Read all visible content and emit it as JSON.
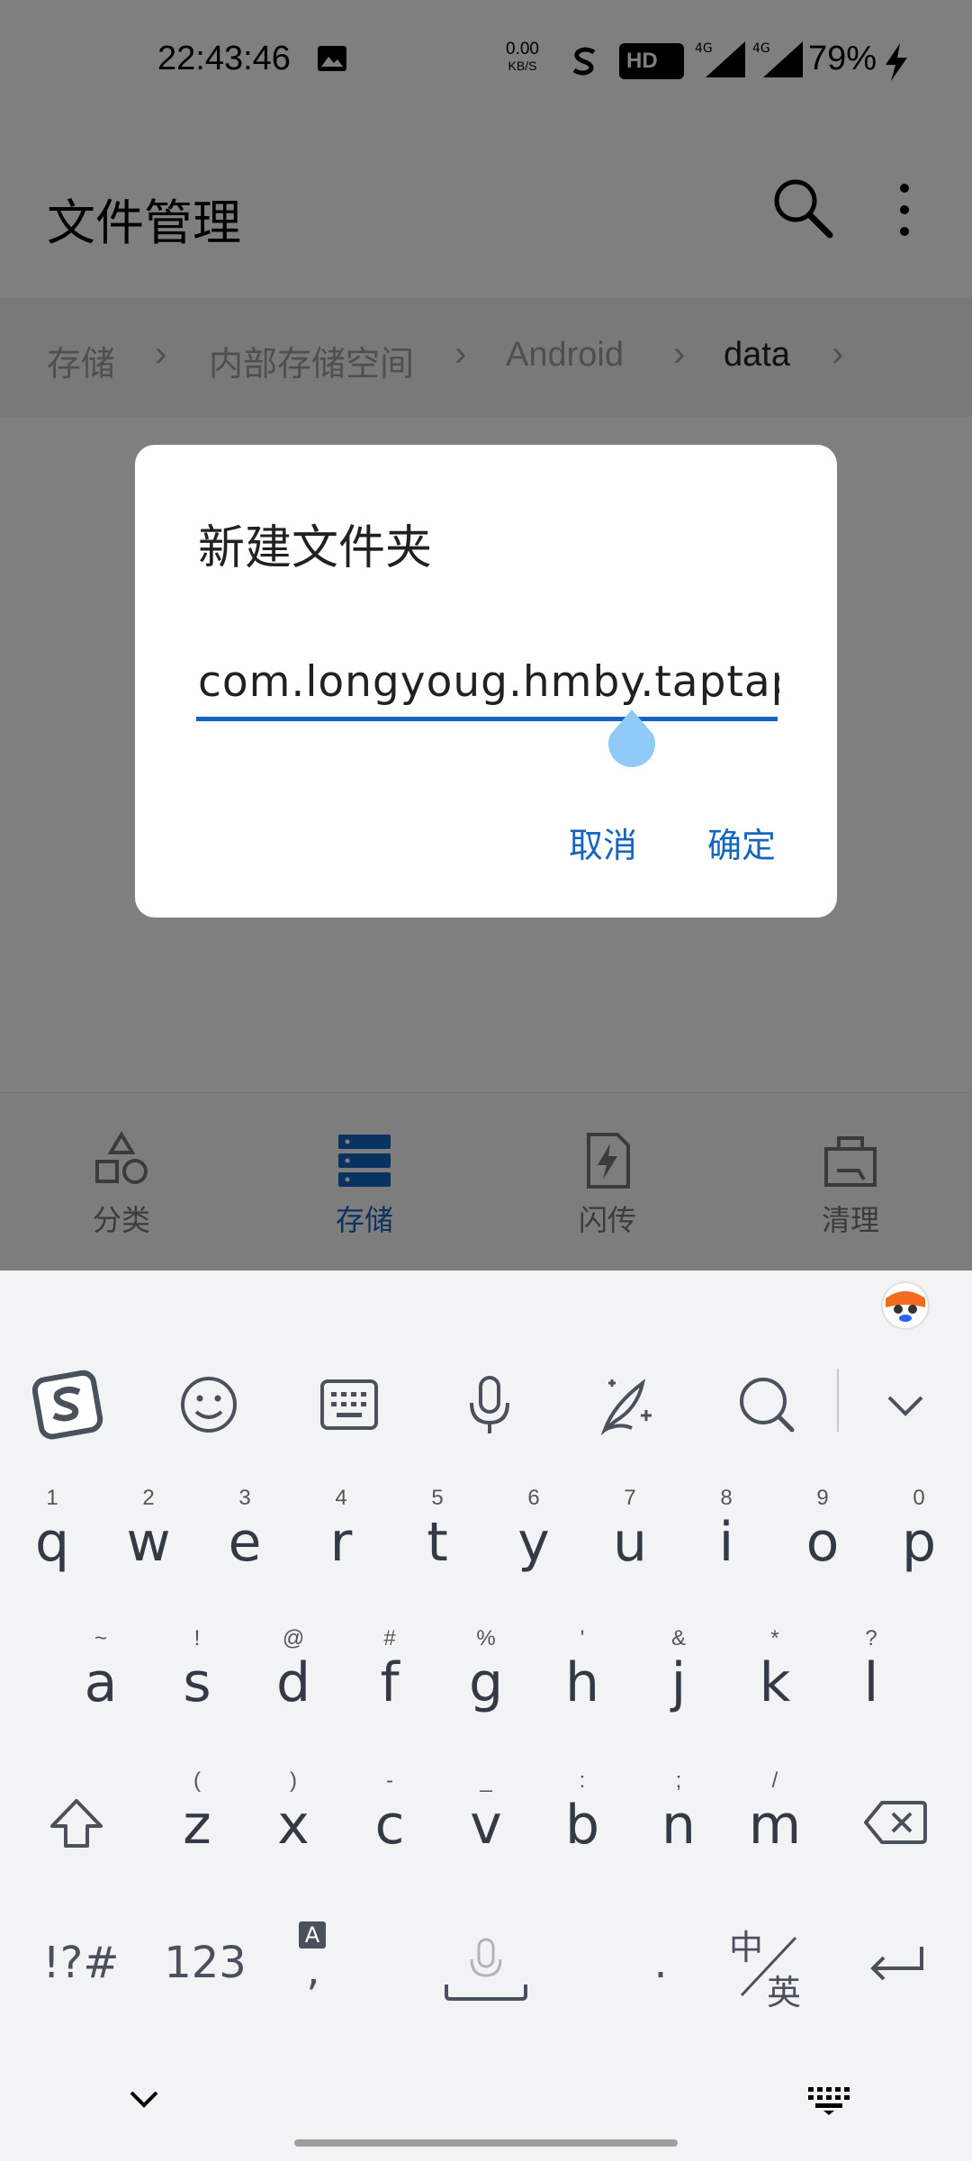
{
  "status_bar": {
    "time": "22:43:46",
    "net_speed_value": "0.00",
    "net_speed_unit": "KB/S",
    "hd_label": "HD",
    "network_1": "4G",
    "network_2": "4G",
    "battery": "79%"
  },
  "app_bar": {
    "title": "文件管理"
  },
  "breadcrumb": [
    "存储",
    "内部存储空间",
    "Android",
    "data"
  ],
  "bottom_nav": [
    {
      "label": "分类",
      "icon": "category-icon",
      "active": false
    },
    {
      "label": "存储",
      "icon": "storage-icon",
      "active": true
    },
    {
      "label": "闪传",
      "icon": "flash-transfer-icon",
      "active": false
    },
    {
      "label": "清理",
      "icon": "cleanup-icon",
      "active": false
    }
  ],
  "dialog": {
    "title": "新建文件夹",
    "input_value": "com.longyoug.hmby.taptap",
    "cancel_label": "取消",
    "confirm_label": "确定"
  },
  "keyboard": {
    "toolbar": [
      "sogou-logo-icon",
      "emoji-icon",
      "keyboard-layout-icon",
      "microphone-icon",
      "handwriting-icon",
      "search-icon",
      "collapse-icon"
    ],
    "row1": [
      {
        "hint": "1",
        "key": "q"
      },
      {
        "hint": "2",
        "key": "w"
      },
      {
        "hint": "3",
        "key": "e"
      },
      {
        "hint": "4",
        "key": "r"
      },
      {
        "hint": "5",
        "key": "t"
      },
      {
        "hint": "6",
        "key": "y"
      },
      {
        "hint": "7",
        "key": "u"
      },
      {
        "hint": "8",
        "key": "i"
      },
      {
        "hint": "9",
        "key": "o"
      },
      {
        "hint": "0",
        "key": "p"
      }
    ],
    "row2": [
      {
        "hint": "~",
        "key": "a"
      },
      {
        "hint": "!",
        "key": "s"
      },
      {
        "hint": "@",
        "key": "d"
      },
      {
        "hint": "#",
        "key": "f"
      },
      {
        "hint": "%",
        "key": "g"
      },
      {
        "hint": "'",
        "key": "h"
      },
      {
        "hint": "&",
        "key": "j"
      },
      {
        "hint": "*",
        "key": "k"
      },
      {
        "hint": "?",
        "key": "l"
      }
    ],
    "row3": [
      {
        "hint": "(",
        "key": "z"
      },
      {
        "hint": ")",
        "key": "x"
      },
      {
        "hint": "-",
        "key": "c"
      },
      {
        "hint": "_",
        "key": "v"
      },
      {
        "hint": ":",
        "key": "b"
      },
      {
        "hint": ";",
        "key": "n"
      },
      {
        "hint": "/",
        "key": "m"
      }
    ],
    "symbols_label": "!?#",
    "numbers_label": "123",
    "comma_label": ",",
    "comma_hint": "A",
    "period_label": ".",
    "lang_cn": "中",
    "lang_en": "英"
  },
  "colors": {
    "accent": "#1565c0",
    "handle": "#90caf9",
    "keyboard_bg": "#f2f3f5"
  }
}
